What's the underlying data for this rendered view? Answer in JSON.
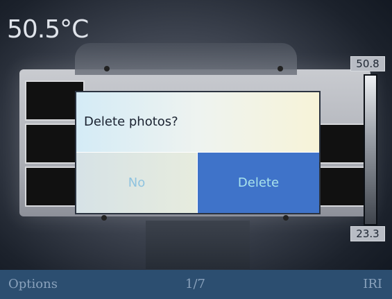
{
  "readout": {
    "temperature": "50.5°C"
  },
  "scale": {
    "max": "50.8",
    "min": "23.3"
  },
  "dialog": {
    "message": "Delete photos?",
    "no_label": "No",
    "delete_label": "Delete"
  },
  "softkeys": {
    "left": "Options",
    "center": "1/7",
    "right": "IRI"
  },
  "colors": {
    "delete_button": "#3f73c9",
    "softkey_bar": "#2c4e70"
  }
}
